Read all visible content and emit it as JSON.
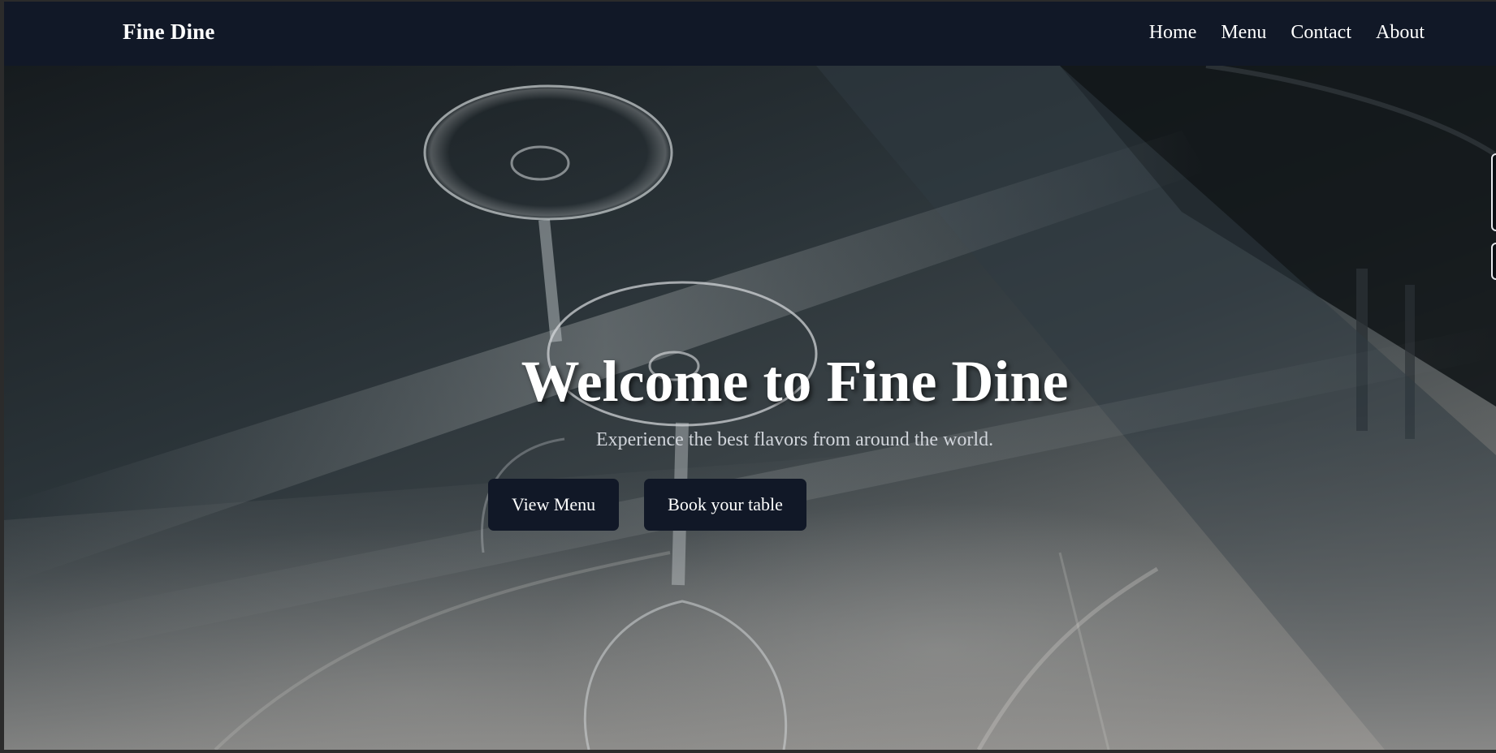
{
  "brand": {
    "name": "Fine Dine"
  },
  "nav": {
    "items": [
      {
        "label": "Home"
      },
      {
        "label": "Menu"
      },
      {
        "label": "Contact"
      },
      {
        "label": "About"
      }
    ]
  },
  "hero": {
    "title": "Welcome to Fine Dine",
    "subtitle": "Experience the best flavors from around the world.",
    "primary_button": "View Menu",
    "secondary_button": "Book your table",
    "background_image": "wine-glasses-on-table-photo"
  },
  "colors": {
    "navbar_bg": "#111827",
    "button_bg": "#111827",
    "text_primary": "#ffffff",
    "text_secondary": "#d1d5db"
  }
}
